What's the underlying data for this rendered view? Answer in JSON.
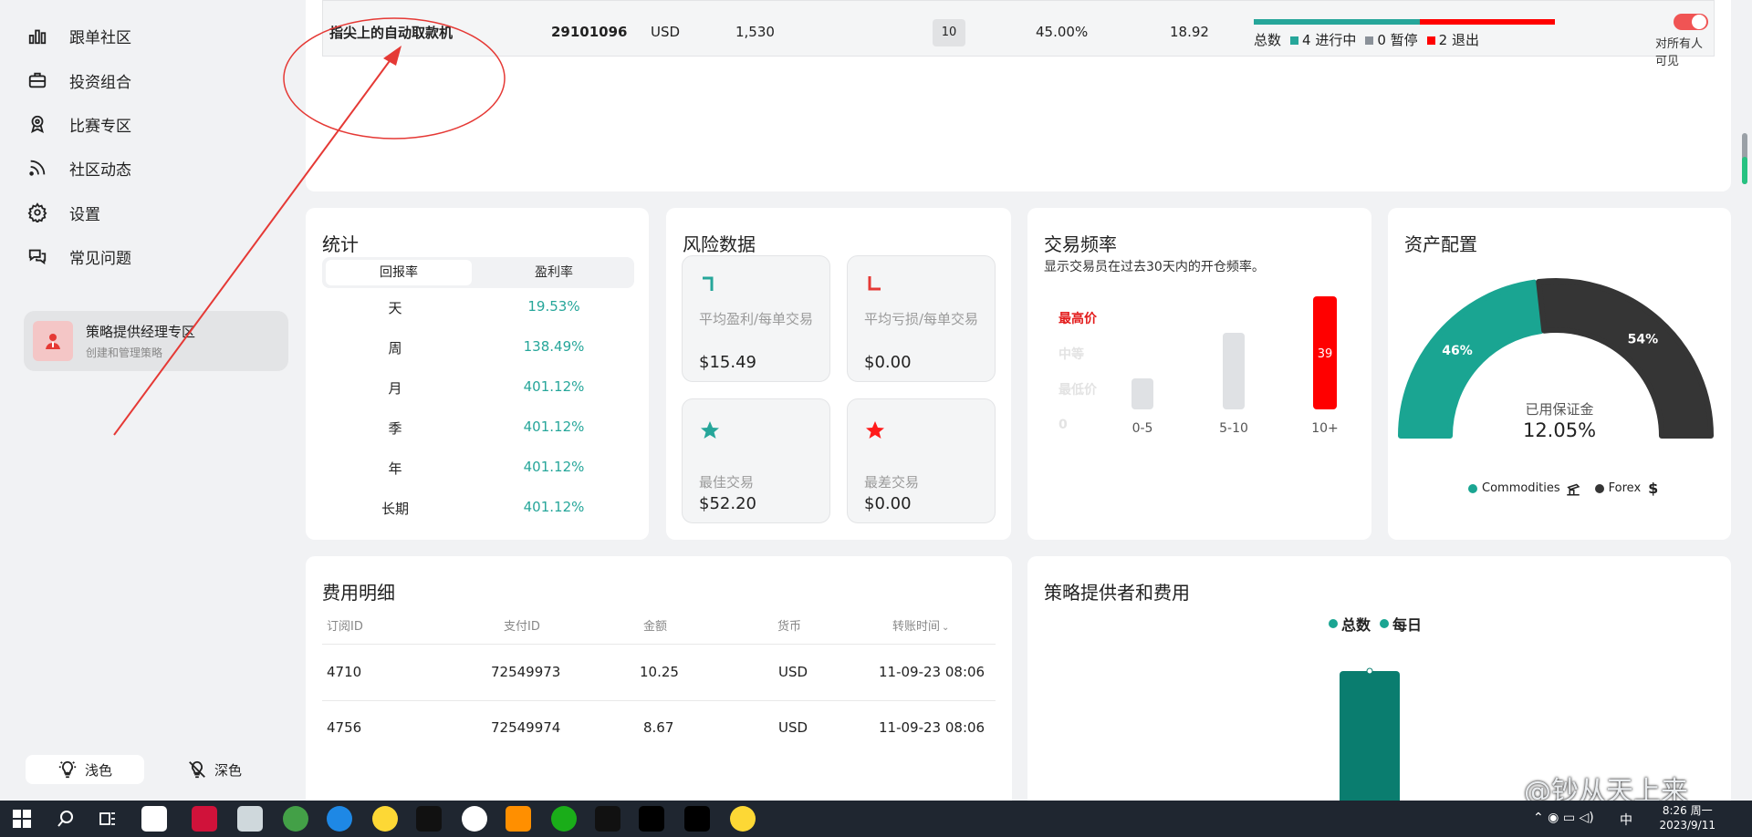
{
  "sidebar": {
    "items": [
      {
        "label": "跟单社区",
        "icon": "bar-chart-icon"
      },
      {
        "label": "投资组合",
        "icon": "briefcase-icon"
      },
      {
        "label": "比赛专区",
        "icon": "medal-icon"
      },
      {
        "label": "社区动态",
        "icon": "rss-icon"
      },
      {
        "label": "设置",
        "icon": "gear-icon"
      },
      {
        "label": "常见问题",
        "icon": "chat-bubbles-icon"
      }
    ],
    "provider_title": "策略提供经理专区",
    "provider_sub": "创建和管理策略",
    "light_label": "浅色",
    "dark_label": "深色"
  },
  "strategy_row": {
    "name": "指尖上的自动取款机",
    "account": "29101096",
    "currency": "USD",
    "balance": "1,530",
    "leverage": "10",
    "pct": "45.00%",
    "value": "18.92",
    "legend_total": "总数",
    "legend_running": "4 进行中",
    "legend_paused": "0 暂停",
    "legend_exited": "2 退出",
    "running_share": 0.55,
    "exited_share": 0.45,
    "visibility": "对所有人可见",
    "colors": {
      "running": "#26a69a",
      "paused": "#8a9199",
      "exited": "#ff0000"
    }
  },
  "stats": {
    "title": "统计",
    "tab_return": "回报率",
    "tab_profit": "盈利率",
    "rows": [
      {
        "period": "天",
        "value": "19.53%"
      },
      {
        "period": "周",
        "value": "138.49%"
      },
      {
        "period": "月",
        "value": "401.12%"
      },
      {
        "period": "季",
        "value": "401.12%"
      },
      {
        "period": "年",
        "value": "401.12%"
      },
      {
        "period": "长期",
        "value": "401.12%"
      }
    ]
  },
  "risk": {
    "title": "风险数据",
    "avg_profit_label": "平均盈利/每单交易",
    "avg_profit_value": "$15.49",
    "avg_loss_label": "平均亏损/每单交易",
    "avg_loss_value": "$0.00",
    "best_label": "最佳交易",
    "best_value": "$52.20",
    "worst_label": "最差交易",
    "worst_value": "$0.00"
  },
  "frequency": {
    "title": "交易频率",
    "subtitle": "显示交易员在过去30天内的开仓频率。",
    "y_labels": [
      "最高价",
      "中等",
      "最低价",
      "0"
    ],
    "chart_data": {
      "type": "bar",
      "categories": [
        "0-5",
        "5-10",
        "10+"
      ],
      "values": [
        0,
        0,
        39
      ],
      "value_label": "39"
    }
  },
  "allocation": {
    "title": "资产配置",
    "center_label": "已用保证金",
    "center_value": "12.05%",
    "chart_data": {
      "type": "pie",
      "labels": [
        "Commodities",
        "Forex"
      ],
      "values": [
        46,
        54
      ],
      "value_labels": [
        "46%",
        "54%"
      ],
      "colors": [
        "#1aa592",
        "#353535"
      ]
    }
  },
  "fees": {
    "title": "费用明细",
    "headers": [
      "订阅ID",
      "支付ID",
      "金额",
      "货币",
      "转账时间"
    ],
    "rows": [
      [
        "4710",
        "72549973",
        "10.25",
        "USD",
        "11-09-23 08:06"
      ],
      [
        "4756",
        "72549974",
        "8.67",
        "USD",
        "11-09-23 08:06"
      ]
    ]
  },
  "providers": {
    "title": "策略提供者和费用",
    "legend_total": "总数",
    "legend_daily": "每日",
    "chart_data": {
      "type": "bar",
      "series": [
        {
          "name": "总数",
          "values": [
            1
          ]
        }
      ],
      "color": "#0a7d6f"
    }
  },
  "watermark": "@钞从天上来",
  "taskbar": {
    "time": "8:26 周一",
    "date": "2023/9/11",
    "ime": "中"
  }
}
